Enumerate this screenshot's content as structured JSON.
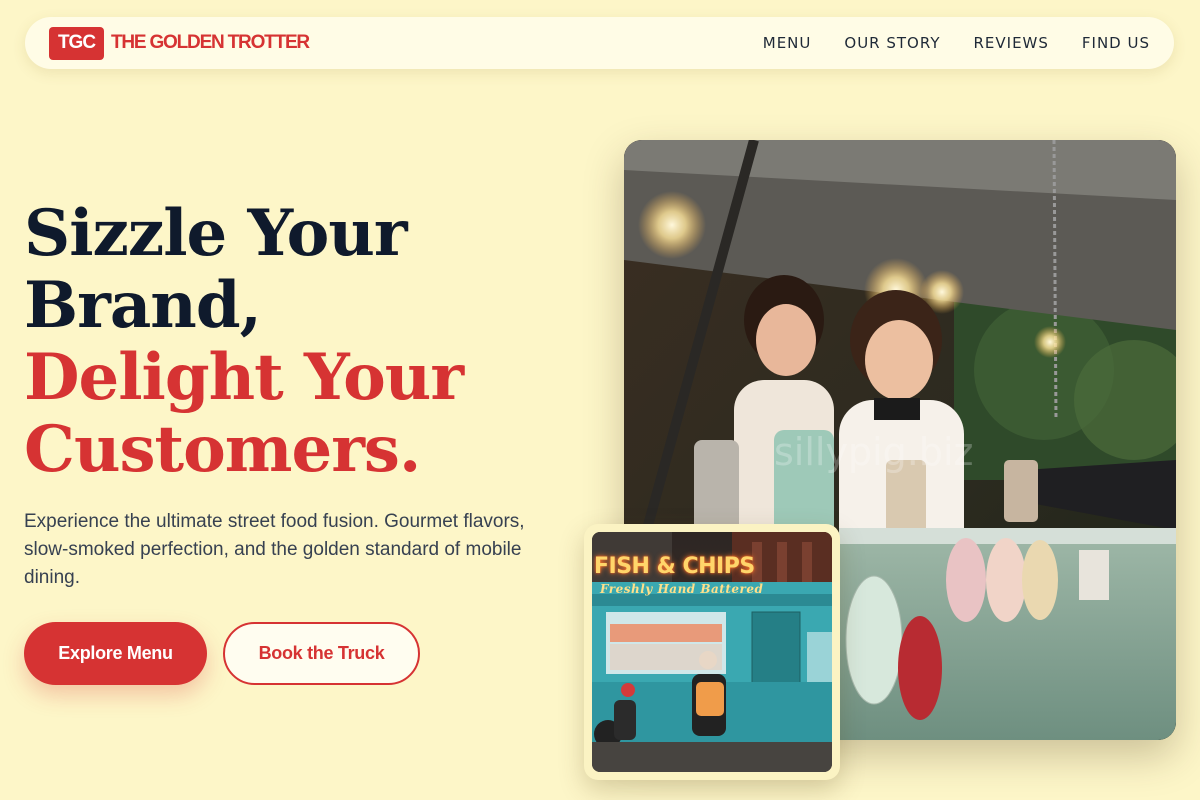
{
  "nav": {
    "logo_abbr": "TGC",
    "brand_name": "THE GOLDEN TROTTER",
    "links": [
      "MENU",
      "OUR STORY",
      "REVIEWS",
      "FIND US"
    ]
  },
  "hero": {
    "line1": "Sizzle Your",
    "line2": "Brand,",
    "line3": "Delight Your",
    "line4": "Customers.",
    "subtext": "Experience the ultimate street food fusion. Gourmet flavors, slow-smoked perfection, and the golden standard of mobile dining.",
    "primary_cta": "Explore Menu",
    "secondary_cta": "Book the Truck"
  },
  "images": {
    "main_alt": "Food truck staff serving customers",
    "small_sign": "FISH & CHIPS",
    "small_sub": "Freshly Hand Battered"
  },
  "colors": {
    "background": "#fdf6c8",
    "accent": "#d63333",
    "heading": "#0f1a2c"
  }
}
